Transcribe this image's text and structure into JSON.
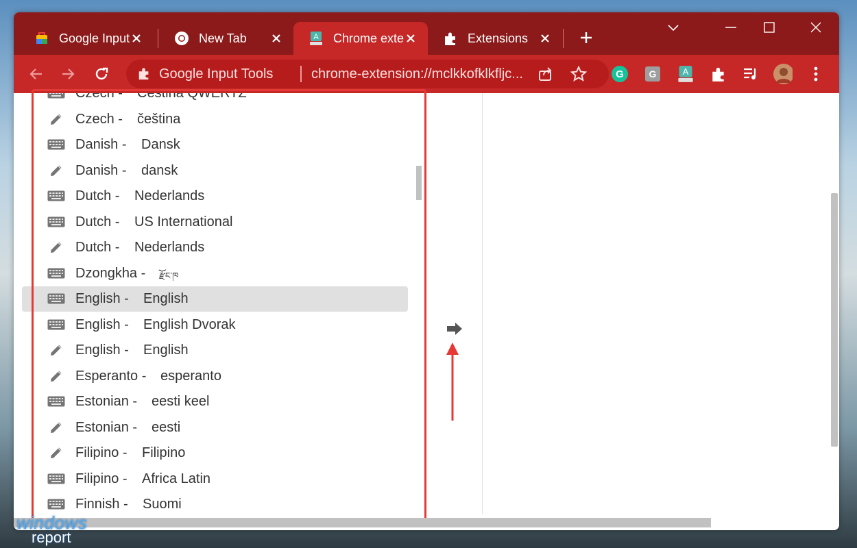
{
  "tabs": [
    {
      "label": "Google Input",
      "icon": "google-input-tools-icon"
    },
    {
      "label": "New Tab",
      "icon": "chrome-icon"
    },
    {
      "label": "Chrome exte",
      "icon": "input-tools-extension-icon",
      "active": true
    },
    {
      "label": "Extensions",
      "icon": "puzzle-icon"
    }
  ],
  "toolbar": {
    "omnibox_title": "Google Input Tools",
    "omnibox_url": "chrome-extension://mclkkofklkfljc..."
  },
  "extensions": [
    "grammarly-icon",
    "g-extension-icon",
    "input-tools-extension-icon",
    "puzzle-icon",
    "media-control-icon",
    "avatar"
  ],
  "languages": [
    {
      "lang": "Czech -",
      "name": "Čeština QWERTZ",
      "type": "keyboard"
    },
    {
      "lang": "Czech -",
      "name": "čeština",
      "type": "handwriting"
    },
    {
      "lang": "Danish -",
      "name": "Dansk",
      "type": "keyboard"
    },
    {
      "lang": "Danish -",
      "name": "dansk",
      "type": "handwriting"
    },
    {
      "lang": "Dutch -",
      "name": "Nederlands",
      "type": "keyboard"
    },
    {
      "lang": "Dutch -",
      "name": "US International",
      "type": "keyboard"
    },
    {
      "lang": "Dutch -",
      "name": "Nederlands",
      "type": "handwriting"
    },
    {
      "lang": "Dzongkha -",
      "name": "རྫོང་ཁ",
      "type": "keyboard"
    },
    {
      "lang": "English -",
      "name": "English",
      "type": "keyboard",
      "selected": true
    },
    {
      "lang": "English -",
      "name": "English Dvorak",
      "type": "keyboard"
    },
    {
      "lang": "English -",
      "name": "English",
      "type": "handwriting"
    },
    {
      "lang": "Esperanto -",
      "name": "esperanto",
      "type": "handwriting"
    },
    {
      "lang": "Estonian -",
      "name": "eesti keel",
      "type": "keyboard"
    },
    {
      "lang": "Estonian -",
      "name": "eesti",
      "type": "handwriting"
    },
    {
      "lang": "Filipino -",
      "name": "Filipino",
      "type": "handwriting"
    },
    {
      "lang": "Filipino -",
      "name": "Africa Latin",
      "type": "keyboard"
    },
    {
      "lang": "Finnish -",
      "name": "Suomi",
      "type": "keyboard"
    }
  ],
  "watermark": {
    "line1": "windows",
    "line2": "report"
  },
  "colors": {
    "tabstrip": "#8c1a1a",
    "toolbar": "#c62828",
    "highlight": "#e53935"
  }
}
